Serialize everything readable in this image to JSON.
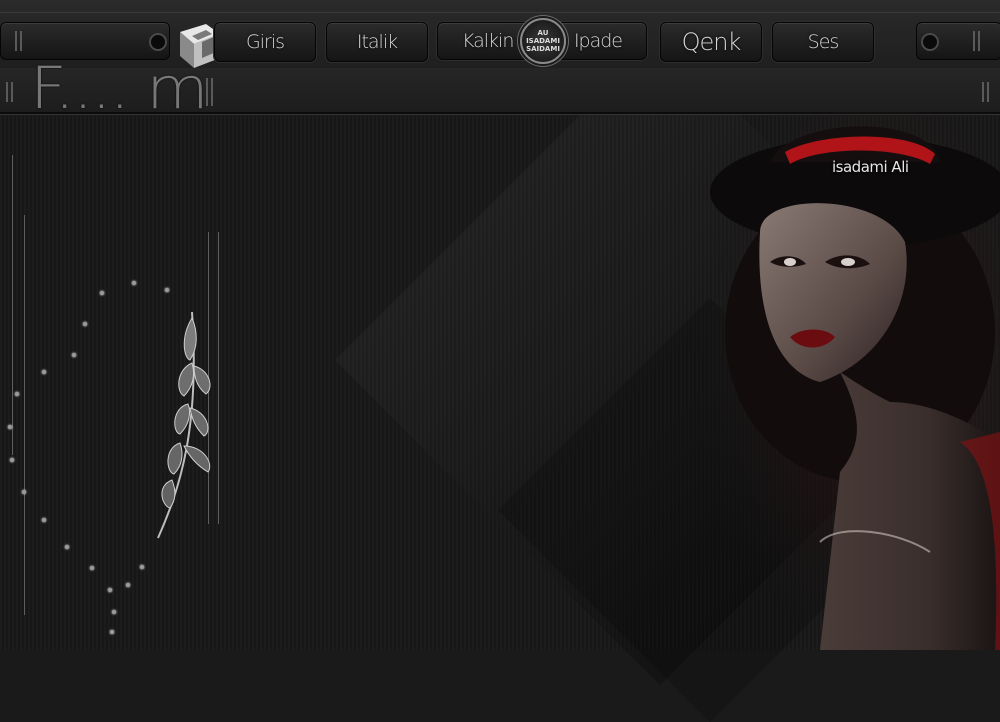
{
  "nav": {
    "items": [
      {
        "label": "Giris"
      },
      {
        "label": "Italik"
      },
      {
        "label": "Kalkin"
      },
      {
        "label": "Ipade"
      },
      {
        "label": "Qenk"
      },
      {
        "label": "Ses"
      }
    ],
    "badge": {
      "line1": "AU",
      "line2": "ISADAMI",
      "line3": "SAIDAMI"
    }
  },
  "title": "F.... m",
  "signature": "isadami Ali",
  "colors": {
    "accent": "#b01418",
    "background": "#1a1a1a",
    "text": "#d6d6d6"
  }
}
